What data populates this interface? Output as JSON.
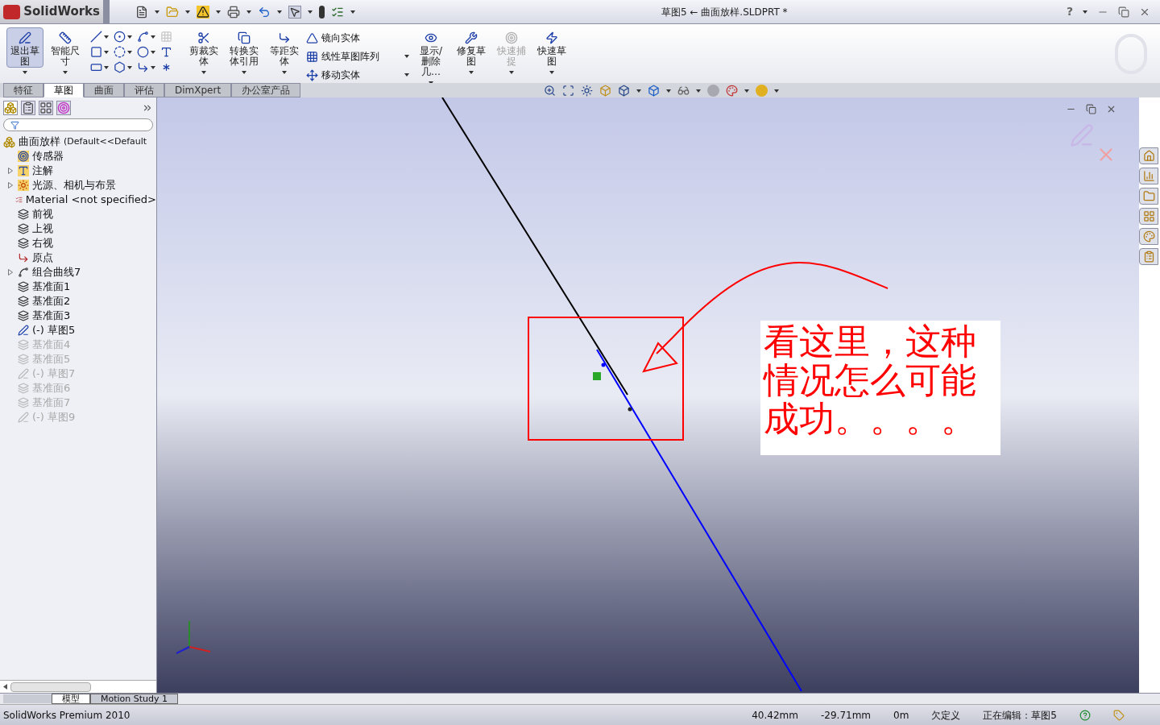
{
  "app": {
    "logo": "SolidWorks",
    "title": "草图5 ← 曲面放样.SLDPRT *",
    "help": "?"
  },
  "command_groups": [
    {
      "kind": "big",
      "label": "退出草图",
      "selected": true,
      "disabled": false
    },
    {
      "kind": "big",
      "label": "智能尺寸",
      "selected": false,
      "disabled": false
    },
    {
      "kind": "grid"
    },
    {
      "kind": "big",
      "label": "剪裁实体",
      "selected": false,
      "disabled": false
    },
    {
      "kind": "big",
      "label": "转换实体引用",
      "selected": false,
      "disabled": false
    },
    {
      "kind": "big",
      "label": "等距实体",
      "selected": false,
      "disabled": false
    },
    {
      "kind": "list",
      "items": [
        {
          "label": "镜向实体"
        },
        {
          "label": "线性草图阵列"
        },
        {
          "label": "移动实体"
        }
      ]
    },
    {
      "kind": "big",
      "label": "显示/删除几…",
      "selected": false,
      "disabled": false
    },
    {
      "kind": "big",
      "label": "修复草图",
      "selected": false,
      "disabled": false
    },
    {
      "kind": "big",
      "label": "快速捕捉",
      "selected": false,
      "disabled": true
    },
    {
      "kind": "big",
      "label": "快速草图",
      "selected": false,
      "disabled": false
    }
  ],
  "tabs": [
    {
      "label": "特征",
      "selected": false
    },
    {
      "label": "草图",
      "selected": true
    },
    {
      "label": "曲面",
      "selected": false
    },
    {
      "label": "评估",
      "selected": false
    },
    {
      "label": "DimXpert",
      "selected": false
    },
    {
      "label": "办公室产品",
      "selected": false
    }
  ],
  "feature_tree": {
    "root": {
      "label": "曲面放样",
      "suffix": "(Default<<Default",
      "kind": "part",
      "children": [
        {
          "label": "传感器",
          "kind": "sensor",
          "expander": false,
          "disabled": false
        },
        {
          "label": "注解",
          "kind": "annotation",
          "expander": true,
          "disabled": false
        },
        {
          "label": "光源、相机与布景",
          "kind": "lights",
          "expander": true,
          "disabled": false
        },
        {
          "label": "Material <not specified>",
          "kind": "material",
          "expander": false,
          "disabled": false
        },
        {
          "label": "前视",
          "kind": "plane",
          "expander": false,
          "disabled": false
        },
        {
          "label": "上视",
          "kind": "plane",
          "expander": false,
          "disabled": false
        },
        {
          "label": "右视",
          "kind": "plane",
          "expander": false,
          "disabled": false
        },
        {
          "label": "原点",
          "kind": "origin",
          "expander": false,
          "disabled": false
        },
        {
          "label": "组合曲线7",
          "kind": "curve",
          "expander": true,
          "disabled": false
        },
        {
          "label": "基准面1",
          "kind": "plane",
          "expander": false,
          "disabled": false
        },
        {
          "label": "基准面2",
          "kind": "plane",
          "expander": false,
          "disabled": false
        },
        {
          "label": "基准面3",
          "kind": "plane",
          "expander": false,
          "disabled": false
        },
        {
          "label": "(-) 草图5",
          "kind": "sketch",
          "expander": false,
          "disabled": false
        },
        {
          "label": "基准面4",
          "kind": "plane",
          "expander": false,
          "disabled": true
        },
        {
          "label": "基准面5",
          "kind": "plane",
          "expander": false,
          "disabled": true
        },
        {
          "label": "(-) 草图7",
          "kind": "sketch",
          "expander": false,
          "disabled": true
        },
        {
          "label": "基准面6",
          "kind": "plane",
          "expander": false,
          "disabled": true
        },
        {
          "label": "基准面7",
          "kind": "plane",
          "expander": false,
          "disabled": true
        },
        {
          "label": "(-) 草图9",
          "kind": "sketch",
          "expander": false,
          "disabled": true
        }
      ]
    }
  },
  "annotation": {
    "text": "看这里，这种情况怎么可能成功。。。。"
  },
  "bottom_tabs": [
    {
      "label": "模型",
      "selected": true
    },
    {
      "label": "Motion Study 1",
      "selected": false
    }
  ],
  "status_bar": {
    "product": "SolidWorks Premium 2010",
    "fields": [
      "40.42mm",
      "-29.71mm",
      "0m",
      "欠定义",
      "正在编辑：草图5"
    ]
  }
}
